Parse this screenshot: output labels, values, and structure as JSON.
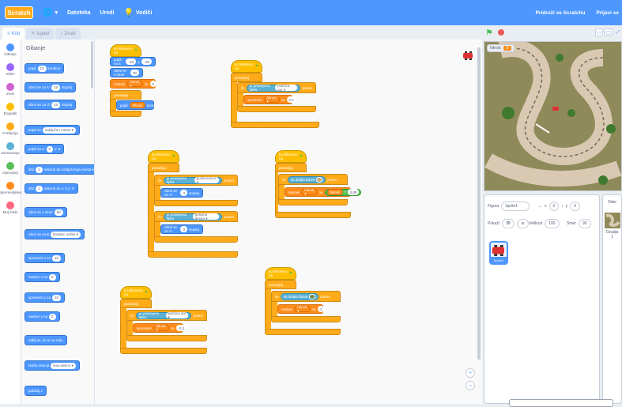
{
  "menubar": {
    "logo": "Scratch",
    "items": [
      {
        "icon": "globe-icon",
        "label": ""
      },
      {
        "icon": "",
        "label": "Datoteka"
      },
      {
        "icon": "",
        "label": "Uredi"
      },
      {
        "icon": "lightbulb-icon",
        "label": "Vodiči"
      }
    ],
    "right": [
      "Pridruži se Scratchu",
      "Prijavi se"
    ]
  },
  "tabs": [
    {
      "label": "Kôd",
      "icon": "code-icon"
    },
    {
      "label": "Izgled",
      "icon": "brush-icon"
    },
    {
      "label": "Zvuki",
      "icon": "speaker-icon"
    }
  ],
  "categories": [
    {
      "label": "Gibanje",
      "color": "#4c97ff"
    },
    {
      "label": "Videz",
      "color": "#9966ff"
    },
    {
      "label": "Zvok",
      "color": "#cf63cf"
    },
    {
      "label": "Dogodki",
      "color": "#ffbf00"
    },
    {
      "label": "Krmiljenje",
      "color": "#ffab19"
    },
    {
      "label": "Zaznavanje",
      "color": "#5cb1d6"
    },
    {
      "label": "Operatorji",
      "color": "#59c059"
    },
    {
      "label": "Spremenljivke",
      "color": "#ff8c1a"
    },
    {
      "label": "Moji bloki",
      "color": "#ff6680"
    }
  ],
  "palette": {
    "title": "Gibanje",
    "blocks": [
      {
        "text": "pojdi",
        "input": "10",
        "suffix": "korakov"
      },
      {
        "text": "obrni se za ↻",
        "input": "15",
        "suffix": "stopinj"
      },
      {
        "text": "obrni se za ↺",
        "input": "15",
        "suffix": "stopinj"
      },
      {
        "text": "pojdi na",
        "input": "naključno mesto ▾",
        "suffix": ""
      },
      {
        "text": "pojdi na x:",
        "input": "0",
        "suffix": "y: 0"
      },
      {
        "text": "drsi",
        "input": "1",
        "suffix": "sekund do naključnega mesta ▾"
      },
      {
        "text": "drsi",
        "input": "1",
        "suffix": "sekund do x: 0 y: 0"
      },
      {
        "text": "obrni se v smer",
        "input": "90",
        "suffix": ""
      },
      {
        "text": "obrni se proti",
        "input": "kazalec miške ▾",
        "suffix": ""
      },
      {
        "text": "spremeni x za",
        "input": "10",
        "suffix": ""
      },
      {
        "text": "nastavi x na",
        "input": "0",
        "suffix": ""
      },
      {
        "text": "spremeni y za",
        "input": "10",
        "suffix": ""
      },
      {
        "text": "nastavi y na",
        "input": "0",
        "suffix": ""
      },
      {
        "text": "odbij se, če si na robu",
        "input": "",
        "suffix": ""
      },
      {
        "text": "Način vrtenja",
        "input": "levo-desno ▾",
        "suffix": ""
      },
      {
        "text": "položaj x",
        "input": "",
        "suffix": ""
      }
    ]
  },
  "scripts": {
    "s1": {
      "hat": "ko kliknemo na",
      "b1": "pojdi na x:",
      "x": "-46",
      "y": "-36",
      "b2": "obrni se v smer",
      "dir": "90",
      "b3": "nastavi",
      "var": "hitrost ▾",
      "b3b": "na",
      "val": "0",
      "ctrl": "ponavljaj",
      "b4": "pojdi",
      "b4var": "hitrost",
      "b4s": "korakov"
    },
    "s2": {
      "hat": "ko kliknemo na",
      "ctrl": "ponavljaj",
      "if": "če",
      "sense": "je pritisnjena tipka",
      "key": "puščica gor ▾",
      "then": "potem",
      "b1": "spremeni",
      "var": "hitrost ▾",
      "za": "za",
      "val": "0.2"
    },
    "s3": {
      "hat": "ko kliknemo na",
      "ctrl": "ponavljaj",
      "if1": "če",
      "sense1": "je pritisnjena tipka",
      "key1": "puščica levo ▾",
      "then1": "potem",
      "b1": "obrni se za ↺",
      "v1": "3",
      "s1": "stopinj",
      "if2": "če",
      "sense2": "je pritisnjena tipka",
      "key2": "puščica desno ▾",
      "then2": "potem",
      "b2": "obrni se za ↻",
      "v2": "3",
      "s2": "stopinj"
    },
    "s4": {
      "hat": "ko kliknemo na",
      "ctrl": "ponavljaj",
      "if": "če",
      "sense": "se dotika barve",
      "then": "potem",
      "b1": "nastavi",
      "var": "hitrost ▾",
      "na": "na",
      "mulvar": "hitrost",
      "mul": "0.85"
    },
    "s5": {
      "hat": "ko kliknemo na",
      "ctrl": "ponavljaj",
      "if": "če",
      "sense": "je pritisnjena tipka",
      "key": "puščica dol ▾",
      "then": "potem",
      "b1": "spremeni",
      "var": "hitrost ▾",
      "za": "za",
      "val": "-0.2"
    },
    "s6": {
      "hat": "ko kliknemo na",
      "ctrl": "ponavljaj",
      "if": "če",
      "sense": "se dotika barve",
      "then": "potem",
      "b1": "nastavi",
      "var": "hitrost ▾",
      "na": "na",
      "val": "0"
    }
  },
  "stage": {
    "monitor_label": "hitrost",
    "monitor_value": "0"
  },
  "sprite_info": {
    "sprite_label": "Figura",
    "sprite_name": "Sprite1",
    "x_label": "x",
    "x": "0",
    "y_label": "y",
    "y": "0",
    "show_label": "Pokaži",
    "size_label": "Velikost",
    "size": "100",
    "dir_label": "Smer",
    "dir": "90",
    "tile_name": "Sprite1"
  },
  "stage_pane": {
    "title": "Oder",
    "backdrops_label": "Ozadja",
    "backdrops_count": "1"
  }
}
